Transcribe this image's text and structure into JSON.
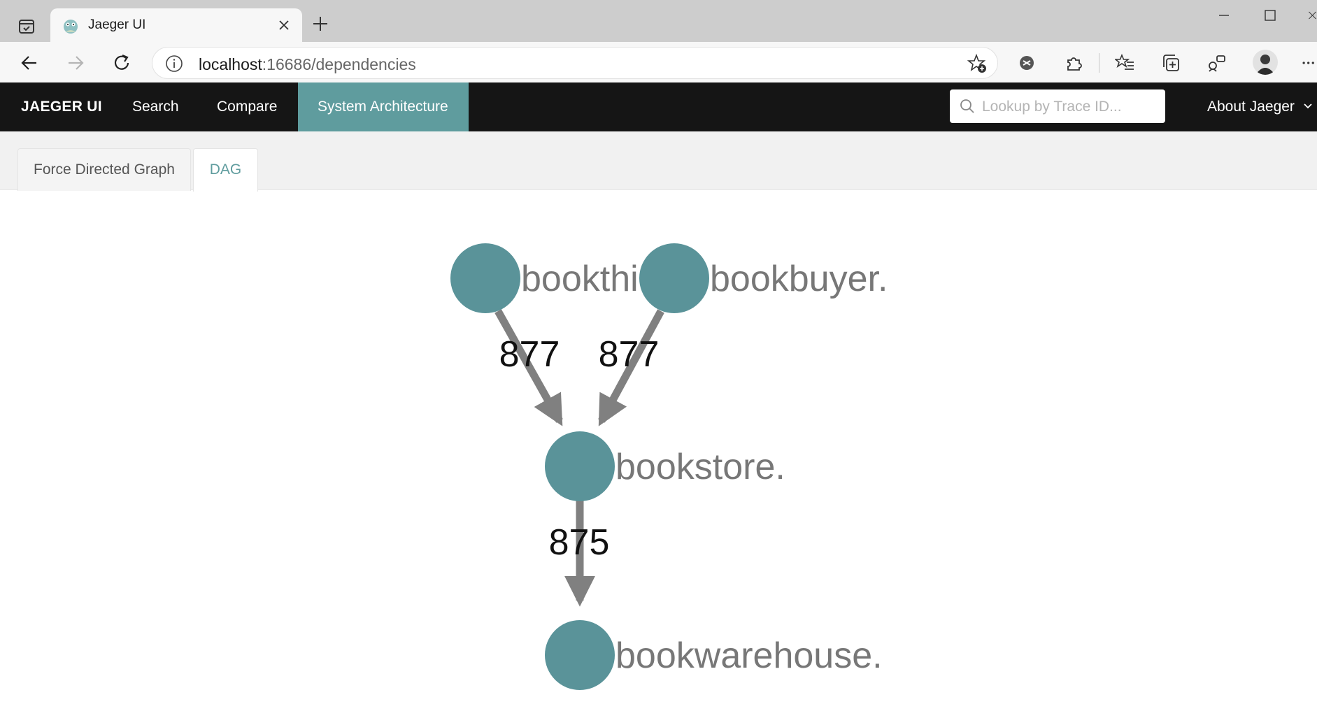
{
  "browser": {
    "tab_title": "Jaeger UI",
    "url_host": "localhost",
    "url_path": ":16686/dependencies",
    "icons": [
      "tab-actions-icon",
      "favicon-icon",
      "close-icon",
      "plus-icon",
      "minimize-icon",
      "maximize-icon",
      "back-icon",
      "forward-icon",
      "refresh-icon",
      "info-icon",
      "add-favorite-icon",
      "extension-blocker-icon",
      "extensions-icon",
      "favorites-icon",
      "collections-icon",
      "share-icon",
      "profile-avatar",
      "more-icon"
    ]
  },
  "nav": {
    "brand": "JAEGER UI",
    "search": "Search",
    "compare": "Compare",
    "system_architecture": "System Architecture",
    "lookup_placeholder": "Lookup by Trace ID...",
    "about": "About Jaeger",
    "active_color": "#5f9c9e"
  },
  "subtabs": {
    "force_directed": "Force Directed Graph",
    "dag": "DAG",
    "active": "DAG"
  },
  "graph": {
    "node_color": "#5a9399",
    "edge_color": "#808080",
    "nodes": [
      {
        "id": "n1",
        "label": "bookthi"
      },
      {
        "id": "n2",
        "label": "bookbuyer."
      },
      {
        "id": "n3",
        "label": "bookstore."
      },
      {
        "id": "n4",
        "label": "bookwarehouse."
      }
    ],
    "edges": [
      {
        "from": "n1",
        "to": "n3",
        "label": "877"
      },
      {
        "from": "n2",
        "to": "n3",
        "label": "877"
      },
      {
        "from": "n3",
        "to": "n4",
        "label": "875"
      }
    ]
  }
}
